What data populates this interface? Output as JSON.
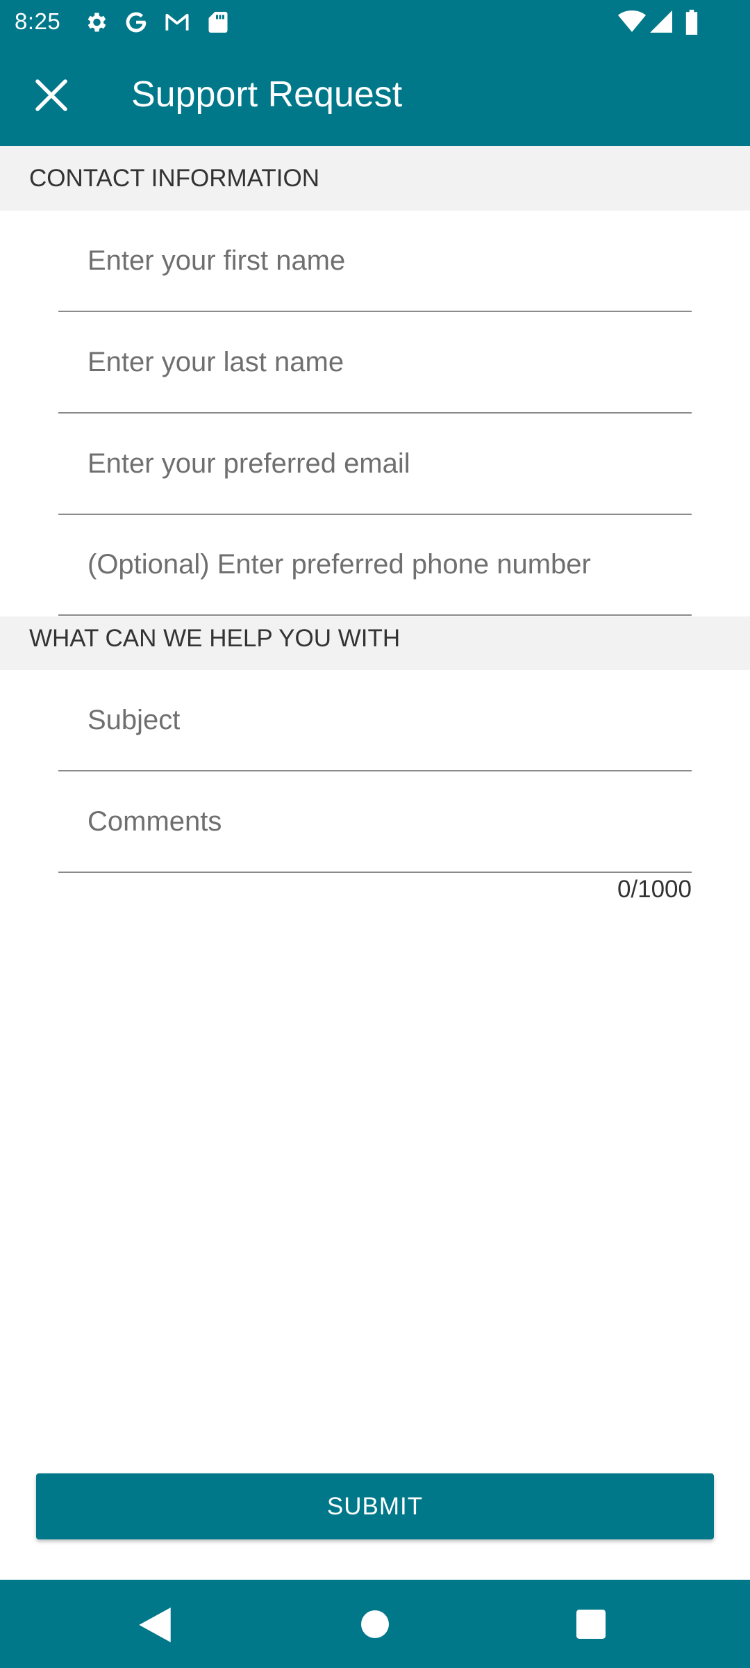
{
  "status_bar": {
    "time": "8:25",
    "left_icons": [
      "settings-gear-icon",
      "google-g-icon",
      "gmail-icon",
      "sd-card-icon"
    ],
    "right_icons": [
      "wifi-icon",
      "cell-signal-icon",
      "battery-icon"
    ]
  },
  "app_bar": {
    "title": "Support Request",
    "close_icon": "close-icon"
  },
  "sections": {
    "contact": {
      "header": "CONTACT INFORMATION"
    },
    "help": {
      "header": "WHAT CAN WE HELP YOU WITH"
    }
  },
  "fields": {
    "first_name": {
      "placeholder": "Enter your first name",
      "value": ""
    },
    "last_name": {
      "placeholder": "Enter your last name",
      "value": ""
    },
    "email": {
      "placeholder": "Enter your preferred email",
      "value": ""
    },
    "phone": {
      "placeholder": "(Optional) Enter preferred phone number",
      "value": ""
    },
    "subject": {
      "placeholder": "Subject",
      "value": ""
    },
    "comments": {
      "placeholder": "Comments",
      "value": ""
    }
  },
  "comments_counter": "0/1000",
  "submit_label": "SUBMIT",
  "nav_bar": {
    "back_icon": "back-triangle-icon",
    "home_icon": "home-circle-icon",
    "recents_icon": "recents-square-icon"
  },
  "colors": {
    "primary": "#00788a",
    "section_bg": "#f2f2f2",
    "divider": "#8a8a8a"
  }
}
